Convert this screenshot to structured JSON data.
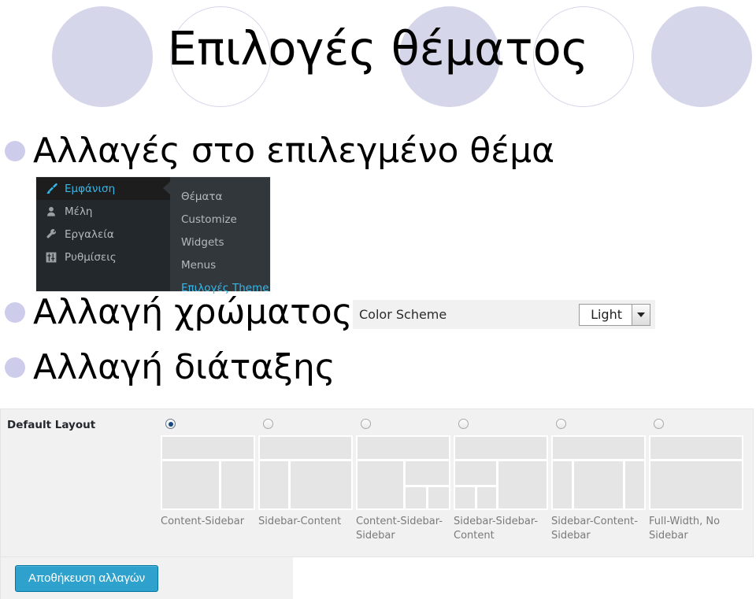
{
  "slide": {
    "title": "Επιλογές θέματος",
    "decor_circle_color": "#d6d6ea",
    "bullet_dot_color": "#cdcdeb",
    "bullets": [
      {
        "text": "Αλλαγές στο επιλεγμένο θέμα"
      },
      {
        "text": "Αλλαγή χρώματος"
      },
      {
        "text": "Αλλαγή διάταξης"
      }
    ]
  },
  "wp_menu": {
    "accent_color": "#36b7e8",
    "background_color": "#23282d",
    "submenu_background_color": "#32373c",
    "items": [
      {
        "label": "Εμφάνιση",
        "icon": "paintbrush-icon",
        "active": true
      },
      {
        "label": "Μέλη",
        "icon": "user-icon",
        "active": false
      },
      {
        "label": "Εργαλεία",
        "icon": "wrench-icon",
        "active": false
      },
      {
        "label": "Ρυθμίσεις",
        "icon": "settings-sliders-icon",
        "active": false
      }
    ],
    "submenu": [
      {
        "label": "Θέματα",
        "current": false
      },
      {
        "label": "Customize",
        "current": false
      },
      {
        "label": "Widgets",
        "current": false
      },
      {
        "label": "Menus",
        "current": false
      },
      {
        "label": "Επιλογές Theme",
        "current": true
      }
    ]
  },
  "color_scheme": {
    "label": "Color Scheme",
    "value": "Light",
    "options": [
      "Light"
    ]
  },
  "default_layout": {
    "label": "Default Layout",
    "selected_index": 0,
    "options": [
      {
        "caption": "Content-Sidebar"
      },
      {
        "caption": "Sidebar-Content"
      },
      {
        "caption": "Content-Sidebar-Sidebar"
      },
      {
        "caption": "Sidebar-Sidebar-Content"
      },
      {
        "caption": "Sidebar-Content-Sidebar"
      },
      {
        "caption": "Full-Width, No Sidebar"
      }
    ]
  },
  "actions": {
    "save_label": "Αποθήκευση αλλαγών",
    "save_color": "#2ea2cc"
  }
}
